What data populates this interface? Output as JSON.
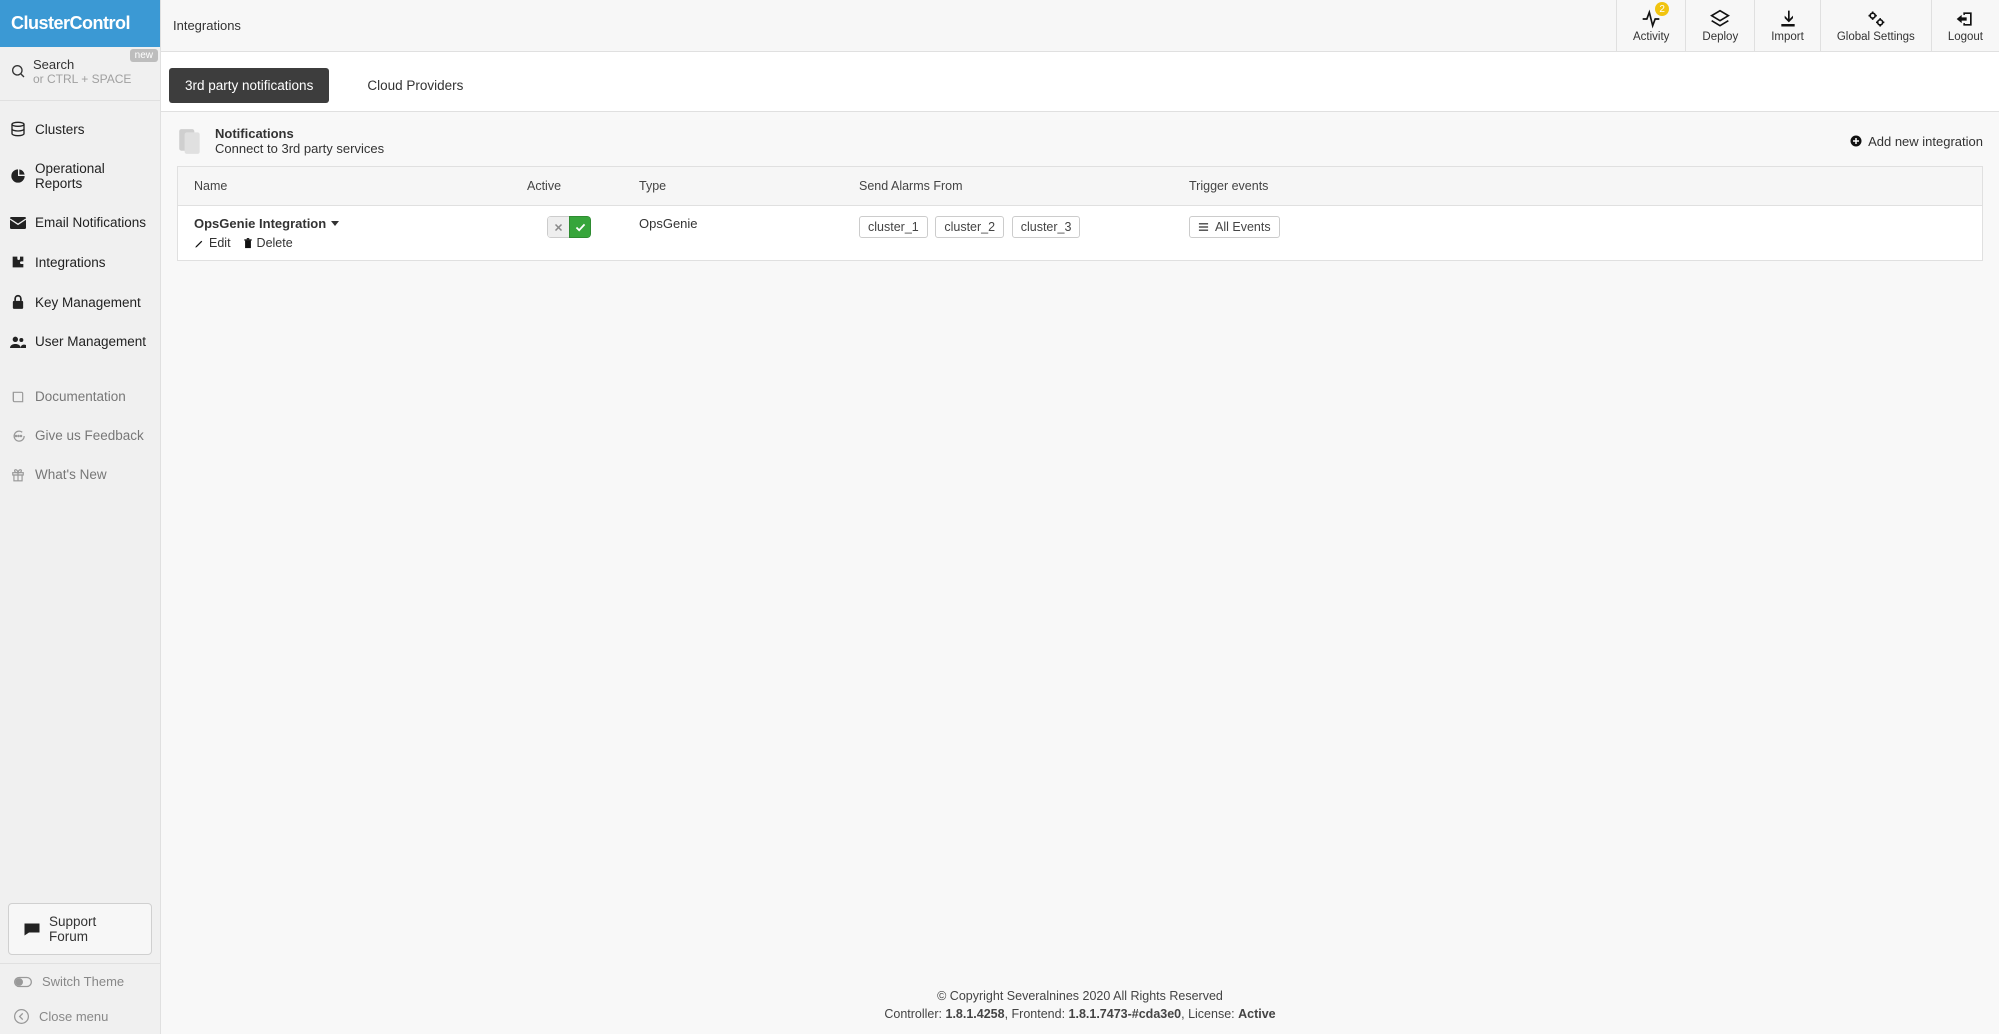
{
  "brand": "ClusterControl",
  "search": {
    "label": "Search",
    "hint": "or CTRL + SPACE",
    "new_badge": "new"
  },
  "sidebar": {
    "items": [
      {
        "label": "Clusters"
      },
      {
        "label": "Operational Reports"
      },
      {
        "label": "Email Notifications"
      },
      {
        "label": "Integrations"
      },
      {
        "label": "Key Management"
      },
      {
        "label": "User Management"
      }
    ],
    "secondary": [
      {
        "label": "Documentation"
      },
      {
        "label": "Give us Feedback"
      },
      {
        "label": "What's New"
      }
    ],
    "support_label": "Support Forum",
    "switch_theme": "Switch Theme",
    "close_menu": "Close menu"
  },
  "top": {
    "breadcrumb": "Integrations",
    "activity": {
      "label": "Activity",
      "badge": "2"
    },
    "deploy": {
      "label": "Deploy"
    },
    "import": {
      "label": "Import"
    },
    "global": {
      "label": "Global Settings"
    },
    "logout": {
      "label": "Logout"
    }
  },
  "tabs": {
    "third_party": "3rd party notifications",
    "cloud": "Cloud Providers"
  },
  "header": {
    "title": "Notifications",
    "subtitle": "Connect to 3rd party services",
    "add_label": "Add new integration"
  },
  "table": {
    "cols": {
      "name": "Name",
      "active": "Active",
      "type": "Type",
      "from": "Send Alarms From",
      "trigger": "Trigger events"
    },
    "row": {
      "name": "OpsGenie Integration",
      "edit": "Edit",
      "delete": "Delete",
      "type": "OpsGenie",
      "clusters": [
        "cluster_1",
        "cluster_2",
        "cluster_3"
      ],
      "events_btn": "All Events"
    }
  },
  "footer": {
    "copyright": "© Copyright Severalnines 2020 All Rights Reserved",
    "controller_label": "Controller: ",
    "controller": "1.8.1.4258",
    "frontend_label": ", Frontend: ",
    "frontend": "1.8.1.7473-#cda3e0",
    "license_label": ", License: ",
    "license": "Active"
  }
}
